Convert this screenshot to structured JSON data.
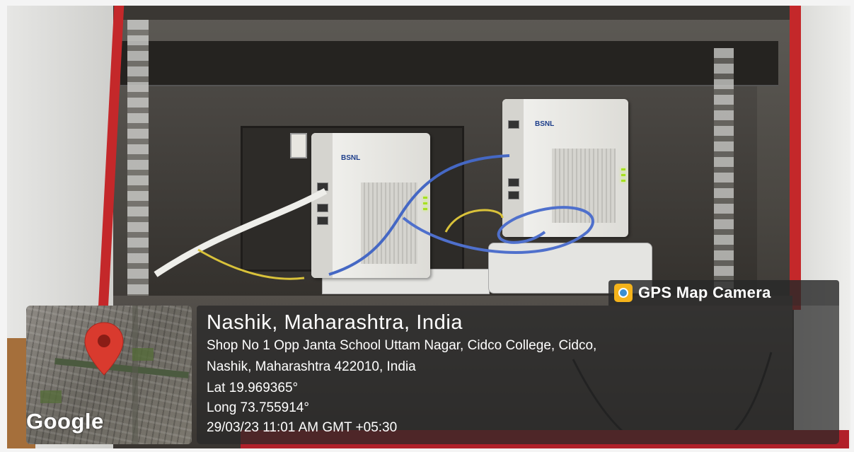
{
  "badge": {
    "label": "GPS Map Camera",
    "icon": "camera-location-icon"
  },
  "location": {
    "title": "Nashik, Maharashtra, India",
    "address_line1": "Shop No 1 Opp Janta School Uttam Nagar, Cidco College, Cidco,",
    "address_line2": "Nashik, Maharashtra 422010, India",
    "latitude": "Lat 19.969365°",
    "longitude": "Long 73.755914°",
    "datetime": "29/03/23 11:01 AM GMT +05:30"
  },
  "map": {
    "attribution": "Google",
    "pin_icon": "map-pin-icon"
  },
  "devices": {
    "brand": "BSNL"
  },
  "colors": {
    "pin": "#d93a2e",
    "badge_bg": "#282828",
    "cabinet_red": "#c4282a"
  }
}
